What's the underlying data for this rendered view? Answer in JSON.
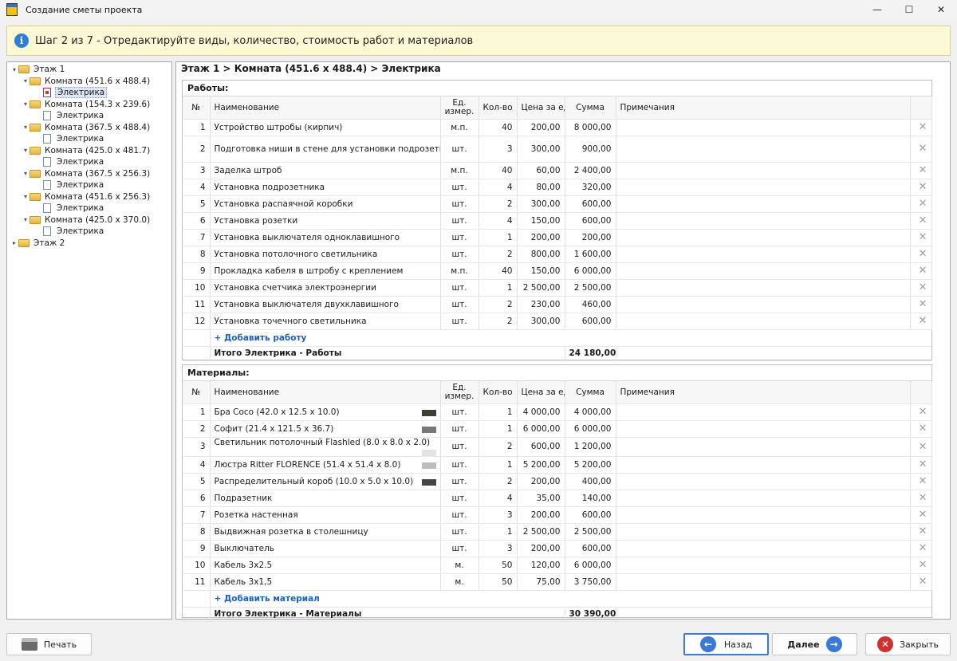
{
  "window": {
    "title": "Создание сметы проекта",
    "min": "—",
    "max": "☐",
    "close": "✕"
  },
  "info": {
    "text": "Шаг 2 из 7 - Отредактируйте виды, количество, стоимость работ и материалов"
  },
  "tree": {
    "floor1": "Этаж 1",
    "floor2": "Этаж 2",
    "rooms": [
      {
        "label": "Комната (451.6 x 488.4)",
        "child": "Электрика"
      },
      {
        "label": "Комната (154.3 x 239.6)",
        "child": "Электрика"
      },
      {
        "label": "Комната (367.5 x 488.4)",
        "child": "Электрика"
      },
      {
        "label": "Комната (425.0 x 481.7)",
        "child": "Электрика"
      },
      {
        "label": "Комната (367.5 x 256.3)",
        "child": "Электрика"
      },
      {
        "label": "Комната (451.6 x 256.3)",
        "child": "Электрика"
      },
      {
        "label": "Комната (425.0 x 370.0)",
        "child": "Электрика"
      }
    ]
  },
  "breadcrumb": "Этаж 1 > Комната (451.6 x 488.4) > Электрика",
  "columns": {
    "no": "№",
    "name": "Наименование",
    "unit": "Ед. измер.",
    "qty": "Кол-во",
    "price": "Цена за ед.",
    "sum": "Сумма",
    "notes": "Примечания"
  },
  "works": {
    "title": "Работы:",
    "rows": [
      {
        "no": "1",
        "name": "Устройство штробы (кирпич)",
        "unit": "м.п.",
        "qty": "40",
        "price": "200,00",
        "sum": "8 000,00"
      },
      {
        "no": "2",
        "name": "Подготовка ниши в стене для установки подрозетника (кирпич)",
        "unit": "шт.",
        "qty": "3",
        "price": "300,00",
        "sum": "900,00"
      },
      {
        "no": "3",
        "name": "Заделка штроб",
        "unit": "м.п.",
        "qty": "40",
        "price": "60,00",
        "sum": "2 400,00"
      },
      {
        "no": "4",
        "name": "Установка подрозетника",
        "unit": "шт.",
        "qty": "4",
        "price": "80,00",
        "sum": "320,00"
      },
      {
        "no": "5",
        "name": "Установка распаячной коробки",
        "unit": "шт.",
        "qty": "2",
        "price": "300,00",
        "sum": "600,00"
      },
      {
        "no": "6",
        "name": "Установка розетки",
        "unit": "шт.",
        "qty": "4",
        "price": "150,00",
        "sum": "600,00"
      },
      {
        "no": "7",
        "name": "Установка выключателя одноклавишного",
        "unit": "шт.",
        "qty": "1",
        "price": "200,00",
        "sum": "200,00"
      },
      {
        "no": "8",
        "name": "Установка потолочного светильника",
        "unit": "шт.",
        "qty": "2",
        "price": "800,00",
        "sum": "1 600,00"
      },
      {
        "no": "9",
        "name": "Прокладка кабеля в штробу с креплением",
        "unit": "м.п.",
        "qty": "40",
        "price": "150,00",
        "sum": "6 000,00"
      },
      {
        "no": "10",
        "name": "Установка счетчика электроэнергии",
        "unit": "шт.",
        "qty": "1",
        "price": "2 500,00",
        "sum": "2 500,00"
      },
      {
        "no": "11",
        "name": "Установка выключателя двухклавишного",
        "unit": "шт.",
        "qty": "2",
        "price": "230,00",
        "sum": "460,00"
      },
      {
        "no": "12",
        "name": "Установка точечного светильника",
        "unit": "шт.",
        "qty": "2",
        "price": "300,00",
        "sum": "600,00"
      }
    ],
    "add": "+ Добавить работу",
    "total_label": "Итого Электрика - Работы",
    "total_value": "24 180,00"
  },
  "materials": {
    "title": "Материалы:",
    "rows": [
      {
        "no": "1",
        "name": "Бра Coco (42.0 x 12.5 x 10.0)",
        "unit": "шт.",
        "qty": "1",
        "price": "4 000,00",
        "sum": "4 000,00",
        "thumb": "#3a3f33"
      },
      {
        "no": "2",
        "name": "Софит (21.4 x 121.5 x 36.7)",
        "unit": "шт.",
        "qty": "1",
        "price": "6 000,00",
        "sum": "6 000,00",
        "thumb": "#777777"
      },
      {
        "no": "3",
        "name": "Светильник потолочный Flashled (8.0 x 8.0 x 2.0)",
        "unit": "шт.",
        "qty": "2",
        "price": "600,00",
        "sum": "1 200,00",
        "thumb": "#e3e3e3"
      },
      {
        "no": "4",
        "name": "Люстра Ritter FLORENCE (51.4 x 51.4 x 8.0)",
        "unit": "шт.",
        "qty": "1",
        "price": "5 200,00",
        "sum": "5 200,00",
        "thumb": "#bdbdbd"
      },
      {
        "no": "5",
        "name": "Распределительный короб (10.0 x 5.0 x 10.0)",
        "unit": "шт.",
        "qty": "2",
        "price": "200,00",
        "sum": "400,00",
        "thumb": "#444444"
      },
      {
        "no": "6",
        "name": "Подразетник",
        "unit": "шт.",
        "qty": "4",
        "price": "35,00",
        "sum": "140,00"
      },
      {
        "no": "7",
        "name": "Розетка настенная",
        "unit": "шт.",
        "qty": "3",
        "price": "200,00",
        "sum": "600,00"
      },
      {
        "no": "8",
        "name": "Выдвижная розетка в столешницу",
        "unit": "шт.",
        "qty": "1",
        "price": "2 500,00",
        "sum": "2 500,00"
      },
      {
        "no": "9",
        "name": "Выключатель",
        "unit": "шт.",
        "qty": "3",
        "price": "200,00",
        "sum": "600,00"
      },
      {
        "no": "10",
        "name": "Кабель 3х2.5",
        "unit": "м.",
        "qty": "50",
        "price": "120,00",
        "sum": "6 000,00"
      },
      {
        "no": "11",
        "name": "Кабель 3х1,5",
        "unit": "м.",
        "qty": "50",
        "price": "75,00",
        "sum": "3 750,00"
      }
    ],
    "add": "+ Добавить материал",
    "total_label": "Итого Электрика - Материалы",
    "total_value": "30 390,00"
  },
  "buttons": {
    "print": "Печать",
    "back": "Назад",
    "next": "Далее",
    "close": "Закрыть"
  },
  "colors": {
    "info_bg": "#fbf8d6",
    "link": "#1a5fc8",
    "back_icon": "#3a79d4",
    "close_icon": "#d03030"
  }
}
